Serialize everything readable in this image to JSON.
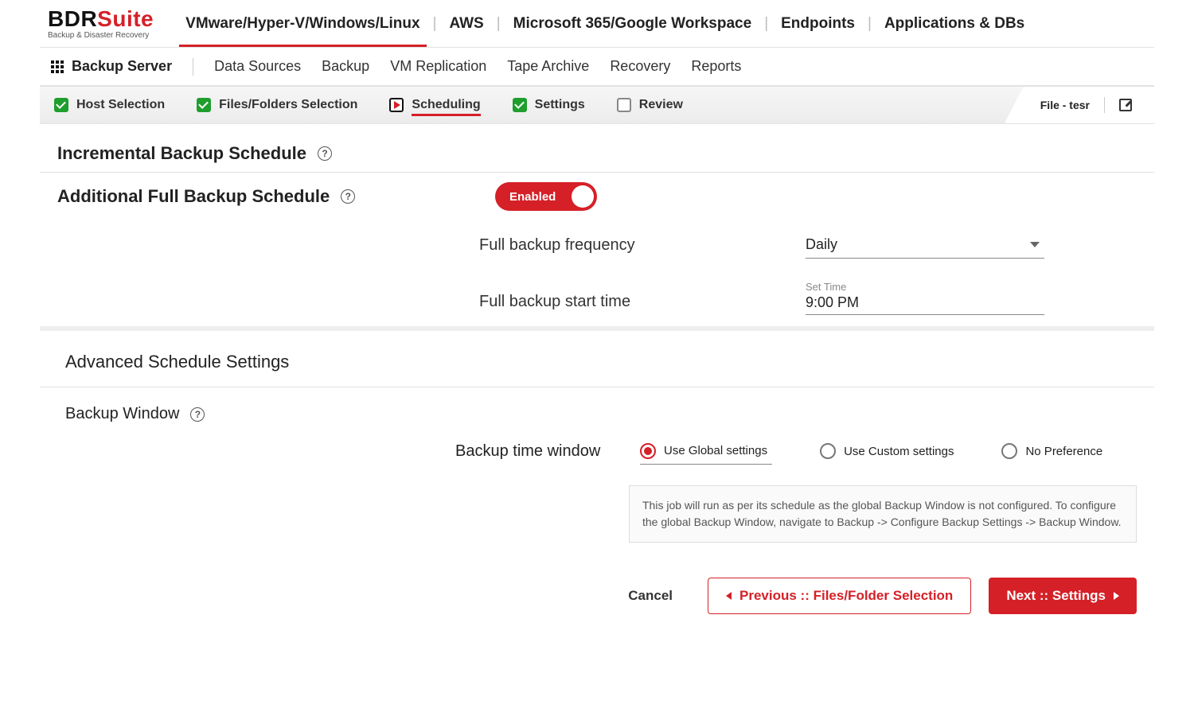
{
  "brand": {
    "name_bdr": "BDR",
    "name_suite": "Suite",
    "tagline": "Backup & Disaster Recovery"
  },
  "topnav": {
    "items": [
      "VMware/Hyper-V/Windows/Linux",
      "AWS",
      "Microsoft 365/Google Workspace",
      "Endpoints",
      "Applications & DBs"
    ],
    "activeIndex": 0
  },
  "menubar": {
    "home": "Backup Server",
    "items": [
      "Data Sources",
      "Backup",
      "VM Replication",
      "Tape Archive",
      "Recovery",
      "Reports"
    ]
  },
  "wizard": {
    "steps": [
      {
        "label": "Host Selection",
        "state": "done"
      },
      {
        "label": "Files/Folders Selection",
        "state": "done"
      },
      {
        "label": "Scheduling",
        "state": "active"
      },
      {
        "label": "Settings",
        "state": "done"
      },
      {
        "label": "Review",
        "state": "empty"
      }
    ],
    "job_name": "File - tesr"
  },
  "sections": {
    "incremental_title": "Incremental Backup Schedule",
    "fullbackup": {
      "title": "Additional Full Backup Schedule",
      "toggle_label": "Enabled",
      "freq_label": "Full backup frequency",
      "freq_value": "Daily",
      "start_label": "Full backup start time",
      "start_hint": "Set Time",
      "start_value": "9:00 PM"
    },
    "advanced_title": "Advanced Schedule Settings",
    "backup_window": {
      "title": "Backup Window",
      "label": "Backup time window",
      "options": [
        "Use Global settings",
        "Use Custom settings",
        "No Preference"
      ],
      "selectedIndex": 0,
      "note": "This job will run as per its schedule as the global Backup Window is not configured. To configure the global Backup Window, navigate to Backup -> Configure Backup Settings -> Backup Window."
    }
  },
  "footer": {
    "cancel": "Cancel",
    "prev": "Previous :: Files/Folder Selection",
    "next": "Next :: Settings"
  }
}
